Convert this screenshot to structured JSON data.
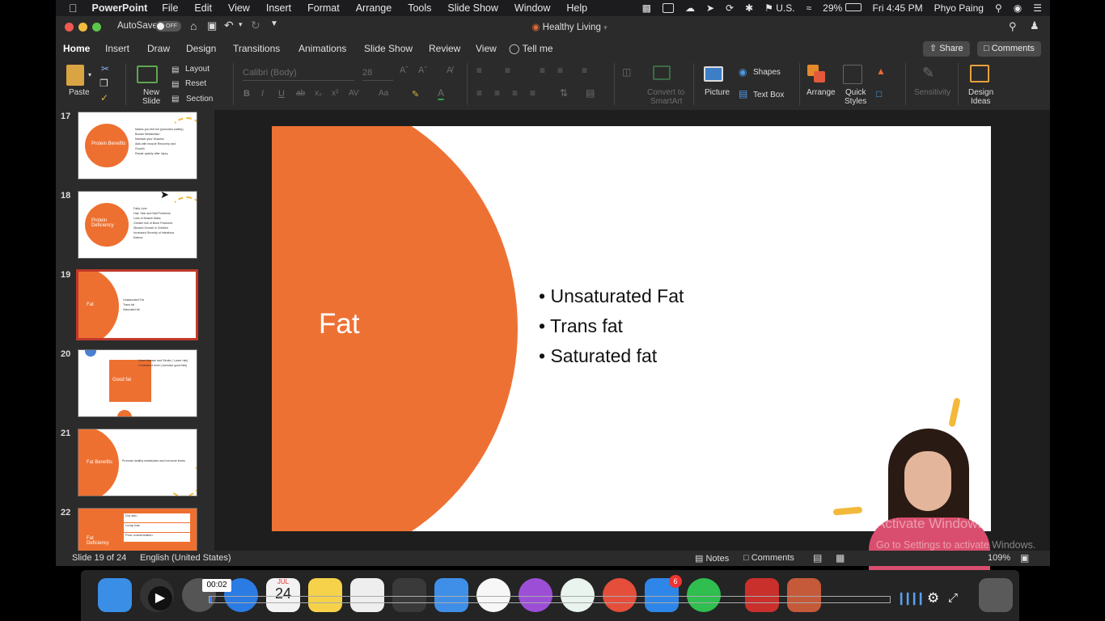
{
  "menubar": {
    "app": "PowerPoint",
    "items": [
      "File",
      "Edit",
      "View",
      "Insert",
      "Format",
      "Arrange",
      "Tools",
      "Slide Show",
      "Window",
      "Help"
    ],
    "locale": "U.S.",
    "battery": "29%",
    "clock": "Fri 4:45 PM",
    "user": "Phyo Paing"
  },
  "titlebar": {
    "autosave_label": "AutoSave",
    "autosave_state": "OFF",
    "document_title": "Healthy Living"
  },
  "tabs": [
    "Home",
    "Insert",
    "Draw",
    "Design",
    "Transitions",
    "Animations",
    "Slide Show",
    "Review",
    "View"
  ],
  "tell_me": "Tell me",
  "share_label": "Share",
  "comments_label": "Comments",
  "ribbon": {
    "paste": "Paste",
    "new_slide_1": "New",
    "new_slide_2": "Slide",
    "layout": "Layout",
    "reset": "Reset",
    "section": "Section",
    "font_name": "Calibri (Body)",
    "font_size": "28",
    "convert_smartart_1": "Convert to",
    "convert_smartart_2": "SmartArt",
    "picture": "Picture",
    "shapes": "Shapes",
    "text_box": "Text Box",
    "arrange": "Arrange",
    "quick_styles_1": "Quick",
    "quick_styles_2": "Styles",
    "sensitivity": "Sensitivity",
    "design_ideas_1": "Design",
    "design_ideas_2": "Ideas"
  },
  "thumbnails": [
    {
      "num": "17",
      "title": "Protein Benefits",
      "bullets": [
        "Makes you feel full (promotes satiety)",
        "Boosts Metabolism",
        "Maintain your Muscles",
        "Aids with muscle Recovery and Growth",
        "Repair quickly after Injury"
      ]
    },
    {
      "num": "18",
      "title": "Protein Deficiency",
      "bullets": [
        "Fatty Liver",
        "Hair, Skin and Nail Problems",
        "Loss of Muscle Mass",
        "Greater risk of Bone Fractures",
        "Stunted Growth in Children",
        "Increased Severity of Infections",
        "Edema"
      ]
    },
    {
      "num": "19",
      "title": "Fat",
      "bullets": [
        "Unsaturated Fat",
        "Trans fat",
        "Saturated fat"
      ]
    },
    {
      "num": "20",
      "title": "Good fat",
      "bullets": [
        "Heart disease and Stroke ( Lower risk)",
        "Cholesterol level ( increase good fats)"
      ]
    },
    {
      "num": "21",
      "title": "Fat Benefits",
      "bullets": [
        "Promote healthy metabolism and hormone levels"
      ]
    },
    {
      "num": "22",
      "title": "Fat Deficiency",
      "bullets": [
        "Dry skin",
        "Lump hair",
        "Poor concentration"
      ]
    }
  ],
  "slide": {
    "title": "Fat",
    "bullets": [
      "Unsaturated Fat",
      "Trans fat",
      "Saturated fat"
    ],
    "accent": "#ee7134"
  },
  "status": {
    "slide_counter": "Slide 19 of 24",
    "language": "English (United States)",
    "notes": "Notes",
    "comments": "Comments",
    "zoom": "109%"
  },
  "video": {
    "time": "00:02",
    "progress_fraction": 0.003,
    "watermark_line1": "Activate Windows",
    "watermark_line2": "Go to Settings to activate Windows."
  },
  "dock": {
    "calendar_month": "JUL",
    "calendar_day": "24",
    "appstore_badge": "6"
  }
}
